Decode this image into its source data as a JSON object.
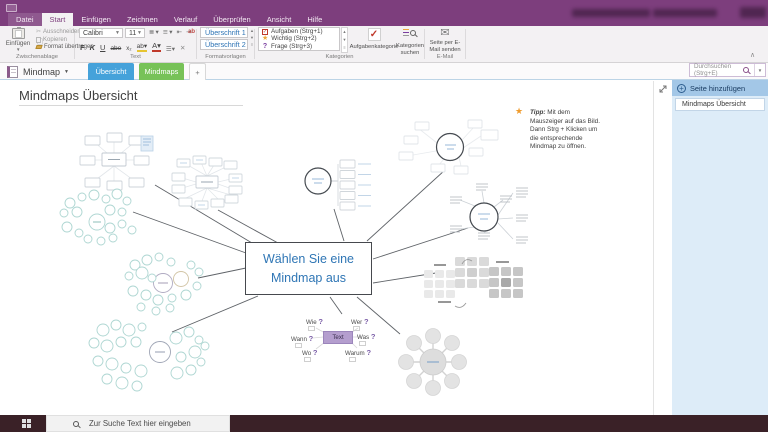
{
  "titlebar": {
    "tabs": [
      "Datei",
      "Start",
      "Einfügen",
      "Zeichnen",
      "Verlauf",
      "Überprüfen",
      "Ansicht",
      "Hilfe"
    ],
    "active_tab": "Start"
  },
  "ribbon": {
    "clipboard": {
      "group_label": "Zwischenablage",
      "paste": "Einfügen",
      "cut": "Ausschneiden",
      "copy": "Kopieren",
      "format_painter": "Format übertragen"
    },
    "text": {
      "group_label": "Text",
      "font_name": "Calibri",
      "font_size": "11"
    },
    "styles": {
      "group_label": "Formatvorlagen",
      "items": [
        "Überschrift 1",
        "Überschrift 2"
      ]
    },
    "tags": {
      "group_label": "Kategorien",
      "items": [
        {
          "icon": "red-checkbox",
          "label": "Aufgaben (Strg+1)"
        },
        {
          "icon": "orange-star",
          "label": "Wichtig (Strg+2)"
        },
        {
          "icon": "purple-question",
          "label": "Frage (Strg+3)"
        }
      ],
      "todo_tag": "Aufgabenkategorie",
      "find_tags": "Kategorien suchen"
    },
    "email": {
      "group_label": "E-Mail",
      "send": "Seite per E-Mail senden"
    }
  },
  "nav": {
    "notebook": "Mindmap",
    "sections": [
      {
        "label": "Übersicht",
        "color": "#45a2da"
      },
      {
        "label": "Mindmaps",
        "color": "#77c258"
      }
    ],
    "new_section": "+",
    "search_placeholder": "Durchsuchen (Strg+E)"
  },
  "page": {
    "title": "Mindmaps Übersicht",
    "center_box": "Wählen Sie eine Mindmap aus",
    "tip_label": "Tipp:",
    "tip_text": "Mit dem Mauszeiger auf das Bild. Dann Strg + Klicken um die entsprechende Mindmap zu öffnen.",
    "question_map": {
      "center": "Text",
      "words": [
        {
          "w": "Wie",
          "q": "?"
        },
        {
          "w": "Wer",
          "q": "?"
        },
        {
          "w": "Wann",
          "q": "?"
        },
        {
          "w": "Was",
          "q": "?"
        },
        {
          "w": "Wo",
          "q": "?"
        },
        {
          "w": "Warum",
          "q": "?"
        }
      ]
    }
  },
  "sidebar": {
    "add_page": "Seite hinzufügen",
    "pages": [
      "Mindmaps Übersicht"
    ]
  },
  "taskbar": {
    "search_placeholder": "Zur Suche Text hier eingeben"
  },
  "colors": {
    "accent_purple": "#7d3e7d",
    "section_blue": "#45a2da",
    "section_green": "#77c258",
    "heading_blue": "#2e74b5",
    "tag_star_orange": "#eda73b",
    "tag_check_red": "#c0392b",
    "taskbar": "#3a2127",
    "panel_blue": "#ddecf8"
  }
}
